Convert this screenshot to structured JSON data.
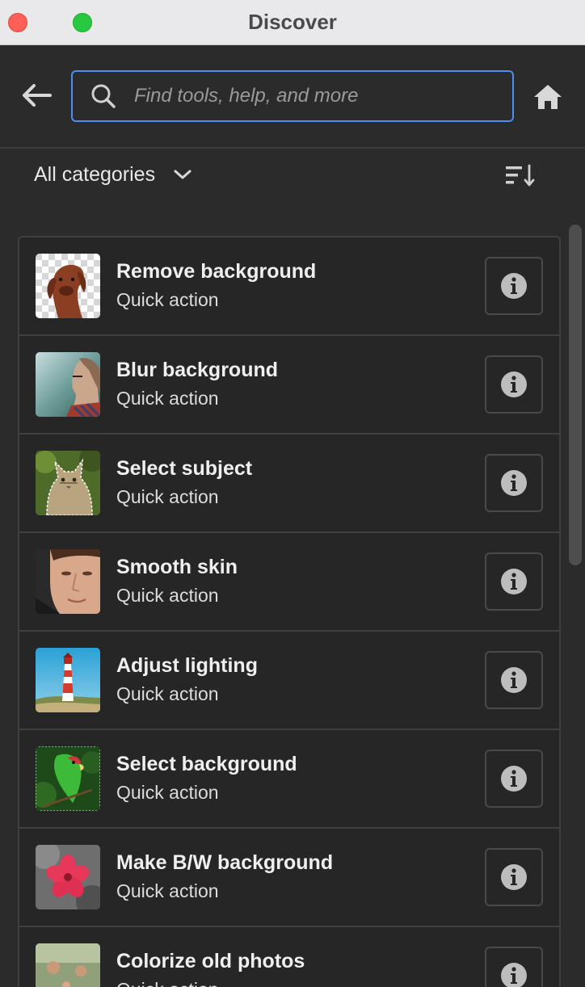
{
  "window": {
    "title": "Discover"
  },
  "search": {
    "placeholder": "Find tools, help, and more"
  },
  "filter": {
    "category_label": "All categories"
  },
  "icons": {
    "back": "arrow-left-icon",
    "search": "magnifier-icon",
    "home": "home-icon",
    "dropdown": "chevron-down-icon",
    "sort": "sort-icon",
    "info": "info-icon"
  },
  "colors": {
    "accent": "#4d8ef3",
    "background": "#2b2b2b",
    "list_background": "#262626"
  },
  "items": [
    {
      "title": "Remove background",
      "subtitle": "Quick action",
      "thumbnail": "dog-on-transparency"
    },
    {
      "title": "Blur background",
      "subtitle": "Quick action",
      "thumbnail": "woman-profile-blurred"
    },
    {
      "title": "Select subject",
      "subtitle": "Quick action",
      "thumbnail": "cat-selected"
    },
    {
      "title": "Smooth skin",
      "subtitle": "Quick action",
      "thumbnail": "face-portrait"
    },
    {
      "title": "Adjust lighting",
      "subtitle": "Quick action",
      "thumbnail": "lighthouse"
    },
    {
      "title": "Select background",
      "subtitle": "Quick action",
      "thumbnail": "parrot"
    },
    {
      "title": "Make B/W background",
      "subtitle": "Quick action",
      "thumbnail": "pink-flower"
    },
    {
      "title": "Colorize old photos",
      "subtitle": "Quick action",
      "thumbnail": "family-photo"
    }
  ]
}
